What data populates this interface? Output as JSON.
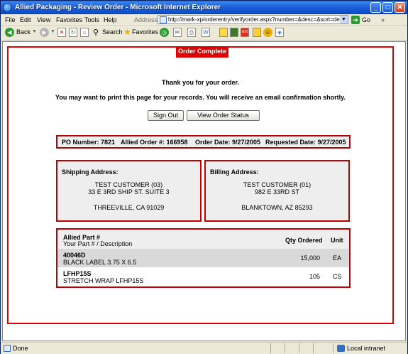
{
  "window": {
    "title": "Allied Packaging - Review Order - Microsoft Internet Explorer",
    "min_glyph": "_",
    "max_glyph": "□",
    "close_glyph": "✕"
  },
  "menu": {
    "items": [
      "File",
      "Edit",
      "View",
      "Favorites",
      "Tools",
      "Help"
    ],
    "address_label": "Address",
    "url": "http://mark-xp/orderentry/verifyorder.aspx?number=&desc=&sort=desc&page=1",
    "go_label": "Go",
    "links_label": "»"
  },
  "toolbar": {
    "back_label": "Back",
    "search_label": "Search",
    "favorites_label": "Favorites"
  },
  "page": {
    "banner": "Order Complete",
    "thanks": "Thank you for your order.",
    "print_message": "You may want to print this page for your records.  You will receive an email confirmation shortly.",
    "sign_out_label": "Sign Out",
    "view_status_label": "View Order Status",
    "po": {
      "po_number": "PO Number: 7821",
      "allied_order": "Allied Order #: 166958",
      "order_date": "Order Date: 9/27/2005",
      "requested_date": "Requested Date: 9/27/2005"
    },
    "shipping": {
      "heading": "Shipping Address:",
      "name": "TEST CUSTOMER (03)",
      "street": "33 E 3RD SHIP ST. SUITE 3",
      "city": "THREEVILLE, CA 91029"
    },
    "billing": {
      "heading": "Billing Address:",
      "name": "TEST CUSTOMER (01)",
      "street": "982 E 33RD ST",
      "city": "BLANKTOWN, AZ 85293"
    },
    "parts": {
      "header": {
        "part": "Allied Part #",
        "desc": "Your Part # / Description",
        "qty": "Qty Ordered",
        "unit": "Unit"
      },
      "rows": [
        {
          "part": "40046D",
          "desc": "BLACK LABEL 3.75 X 6.5",
          "qty": "15,000",
          "unit": "EA"
        },
        {
          "part": "LFHP15S",
          "desc": "STRETCH WRAP LFHP15S",
          "qty": "105",
          "unit": "CS"
        }
      ]
    }
  },
  "status": {
    "done": "Done",
    "zone": "Local intranet"
  },
  "colors": {
    "accent_red": "#e00000",
    "box_fill": "#eeeeee",
    "row_fill": "#d9d9d9"
  }
}
